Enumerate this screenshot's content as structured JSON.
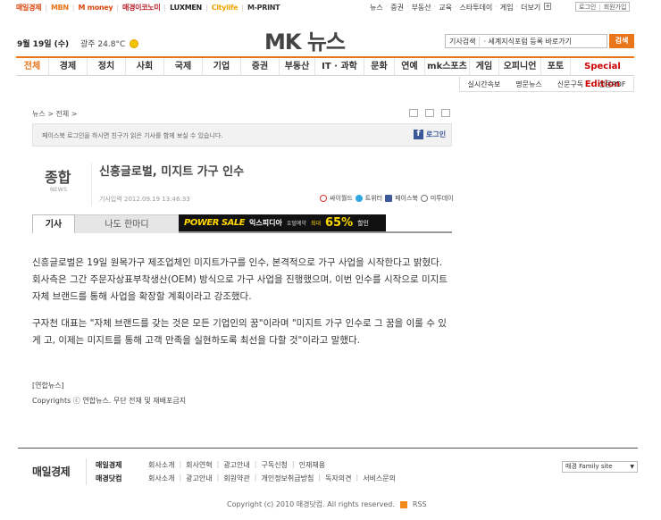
{
  "topbar": {
    "brands": [
      {
        "label": "매일경제",
        "color": "#d9480f"
      },
      {
        "label": "MBN",
        "color": "#e8751a"
      },
      {
        "label": "M money",
        "color": "#d9480f"
      },
      {
        "label": "매경이코노미",
        "color": "#b5232b"
      },
      {
        "label": "LUXMEN",
        "color": "#222222"
      },
      {
        "label": "Citylife",
        "color": "#f0a500"
      },
      {
        "label": "M-PRINT",
        "color": "#333333"
      }
    ],
    "links": [
      "뉴스",
      "증권",
      "부동산",
      "교육",
      "스타투데이",
      "게임",
      "더보기"
    ],
    "auth": [
      "로그인",
      "회원가입"
    ]
  },
  "header": {
    "date": "9월 19일 (수)",
    "weather": "광주 24.8°C",
    "logo": "MK 뉴스",
    "search_type": "기사검색",
    "search_value": "세계지식포럼 등록 바로가기",
    "search_button": "검색"
  },
  "gnb": {
    "items": [
      {
        "label": "전체",
        "w": 36
      },
      {
        "label": "경제",
        "w": 43
      },
      {
        "label": "정치",
        "w": 43
      },
      {
        "label": "사회",
        "w": 43
      },
      {
        "label": "국제",
        "w": 43
      },
      {
        "label": "기업",
        "w": 43
      },
      {
        "label": "증권",
        "w": 43
      },
      {
        "label": "부동산",
        "w": 40
      },
      {
        "label": "IT · 과학",
        "w": 55
      },
      {
        "label": "문화",
        "w": 34
      },
      {
        "label": "연예",
        "w": 34
      },
      {
        "label": "mk스포츠",
        "w": 50
      },
      {
        "label": "게임",
        "w": 33
      },
      {
        "label": "오피니언",
        "w": 47
      },
      {
        "label": "포토",
        "w": 33
      },
      {
        "label": "Special Edition",
        "w": 72
      }
    ],
    "sub": [
      "실시간속보",
      "명문뉴스",
      "신문구독",
      "신문PDF"
    ]
  },
  "article": {
    "breadcrumb": "뉴스 > 전체 >",
    "fb_message": "페이스북 로그인을 하시면 친구가 읽은 기사를 함께 보실 수 있습니다.",
    "fb_login": "로그인",
    "section": "종합",
    "section_en": "NEWS",
    "title": "신흥글로벌, 미지트 가구 인수",
    "byline": "기사입력 2012.09.19 13:46:33",
    "share": [
      "싸이월드",
      "트위터",
      "페이스북",
      "미투데이"
    ],
    "tabs": [
      "기사",
      "나도 한마디"
    ],
    "ad": {
      "power_sale": "POWER SALE",
      "brand": "익스피디아",
      "hotel": "호텔예약",
      "max": "최대",
      "percent": "65%",
      "discount": "할인"
    },
    "paragraphs": [
      "신흥글로벌은 19일 원목가구 제조업체인 미지트가구를 인수, 본격적으로 가구 사업을 시작한다고 밝혔다. 회사측은 그간 주문자상표부착생산(OEM) 방식으로 가구 사업을 진행했으며, 이번 인수를 시작으로 미지트 자체 브랜드를 통해 사업을 확장할 계획이라고 강조했다.",
      "구자천 대표는 \"자체 브랜드를 갖는 것은 모든 기업인의 꿈\"이라며 \"미지트 가구 인수로 그 꿈을 이룰 수 있게 고, 이제는 미지트를 통해 고객 만족을 실현하도록 최선을 다할 것\"이라고 말했다."
    ],
    "source": "[연합뉴스]",
    "copyright": "Copyrights ⓒ 연합뉴스. 무단 전재 및 재배포금지"
  },
  "footer": {
    "logo": "매일경제",
    "corp1": "매일경제",
    "corp2": "매경닷컴",
    "row1": [
      "회사소개",
      "회사연혁",
      "광고안내",
      "구독신청",
      "인재채용"
    ],
    "row2": [
      "회사소개",
      "광고안내",
      "회원약관",
      "개인정보취급방침",
      "독자의견",
      "서비스문의"
    ],
    "family_site": "매경 Family site",
    "copyright": "Copyright (c) 2010 매경닷컴. All rights reserved.",
    "rss": "RSS"
  }
}
